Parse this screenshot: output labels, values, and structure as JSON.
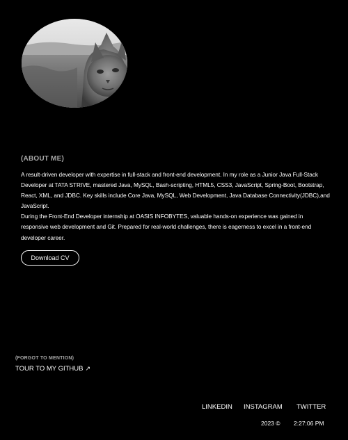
{
  "avatar": {
    "icon": "cat-photo"
  },
  "about": {
    "heading": "(ABOUT ME)",
    "paragraph_1": "A result-driven developer with expertise in full-stack and front-end development. In my role as a Junior Java Full-Stack Developer at TATA STRIVE, mastered Java, MySQL, Bash-scripting, HTML5, CSS3, JavaScript, Spring-Boot, Bootstrap, React, XML, and JDBC. Key skills include Core Java, MySQL, Web Development, Java Database Connectivity(JDBC),and JavaScript.",
    "paragraph_2": "During the Front-End Developer internship at OASIS INFOBYTES, valuable hands-on experience was gained in responsive web development and Git. Prepared for real-world challenges, there is eagerness to excel in a front-end developer career.",
    "download_label": "Download CV"
  },
  "forgot": {
    "heading": "(FORGOT TO MENTION)",
    "github_label": "TOUR TO MY GITHUB",
    "github_icon": "arrow-up-right-icon"
  },
  "social": {
    "linkedin": "LINKEDIN",
    "instagram": "INSTAGRAM",
    "twitter": "TWITTER"
  },
  "footer": {
    "year": "2023 ©",
    "time": "2:27:06 PM"
  },
  "colors": {
    "background": "#000000",
    "text": "#ffffff",
    "muted": "#a8a8a8"
  }
}
